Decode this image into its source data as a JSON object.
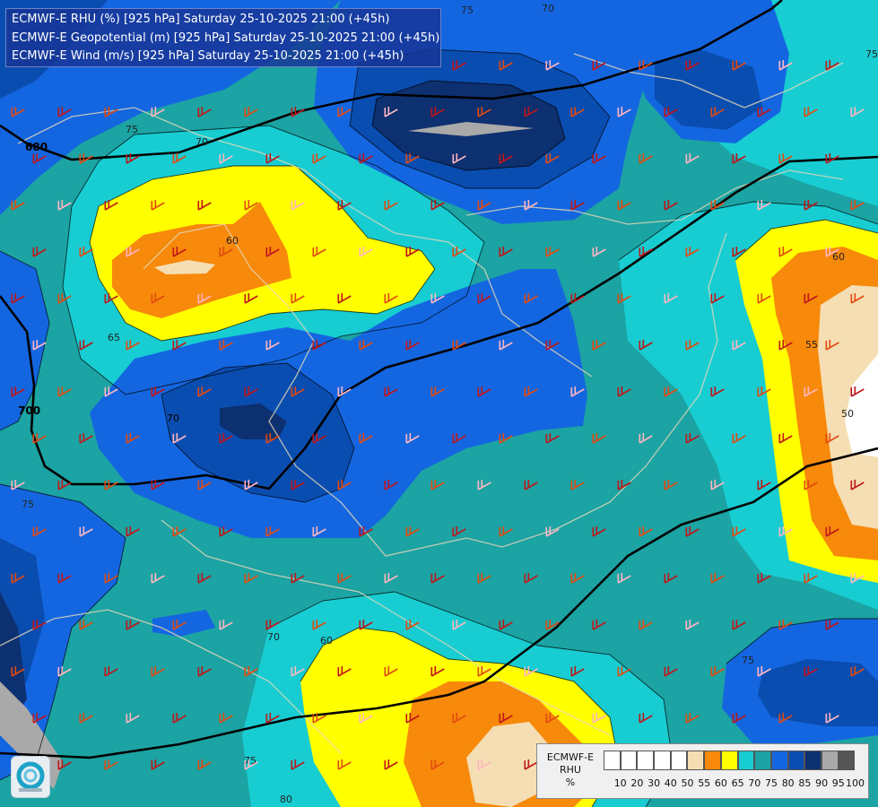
{
  "title_lines": [
    "ECMWF-E RHU (%) [925 hPa] Saturday 25-10-2025 21:00 (+45h)",
    "ECMWF-E Geopotential (m) [925 hPa] Saturday 25-10-2025 21:00 (+45h)",
    "ECMWF-E Wind (m/s) [925 hPa] Saturday 25-10-2025 21:00 (+45h)"
  ],
  "legend": {
    "title_lines": [
      "ECMWF-E",
      "RHU",
      "%"
    ],
    "swatches": [
      {
        "label": "10",
        "color": "#ffffff"
      },
      {
        "label": "20",
        "color": "#ffffff"
      },
      {
        "label": "30",
        "color": "#ffffff"
      },
      {
        "label": "40",
        "color": "#ffffff"
      },
      {
        "label": "50",
        "color": "#ffffff"
      },
      {
        "label": "55",
        "color": "#f5deb3"
      },
      {
        "label": "60",
        "color": "#f7890b"
      },
      {
        "label": "65",
        "color": "#ffff00"
      },
      {
        "label": "70",
        "color": "#17cdd2"
      },
      {
        "label": "75",
        "color": "#1ca3a3"
      },
      {
        "label": "80",
        "color": "#1466e0"
      },
      {
        "label": "85",
        "color": "#0a4db0"
      },
      {
        "label": "90",
        "color": "#0d3070"
      },
      {
        "label": "95",
        "color": "#a9a9a9"
      },
      {
        "label": "100",
        "color": "#555555"
      }
    ]
  },
  "contour_labels": {
    "rhu": [
      "75",
      "70",
      "75",
      "60",
      "65",
      "70",
      "60",
      "55",
      "50",
      "75",
      "75",
      "70",
      "60",
      "75",
      "80",
      "75"
    ],
    "geopotential": [
      "680",
      "700",
      "70"
    ]
  },
  "colors": {
    "rhu_55": "#f5deb3",
    "rhu_60": "#f7890b",
    "rhu_65": "#ffff00",
    "rhu_70": "#17cdd2",
    "rhu_75": "#1ca3a3",
    "rhu_80": "#1466e0",
    "rhu_85": "#0a4db0",
    "rhu_90": "#0d3070",
    "rhu_95": "#a9a9a9",
    "geopotential_line": "#000000",
    "borders": "#e6d8b8"
  }
}
